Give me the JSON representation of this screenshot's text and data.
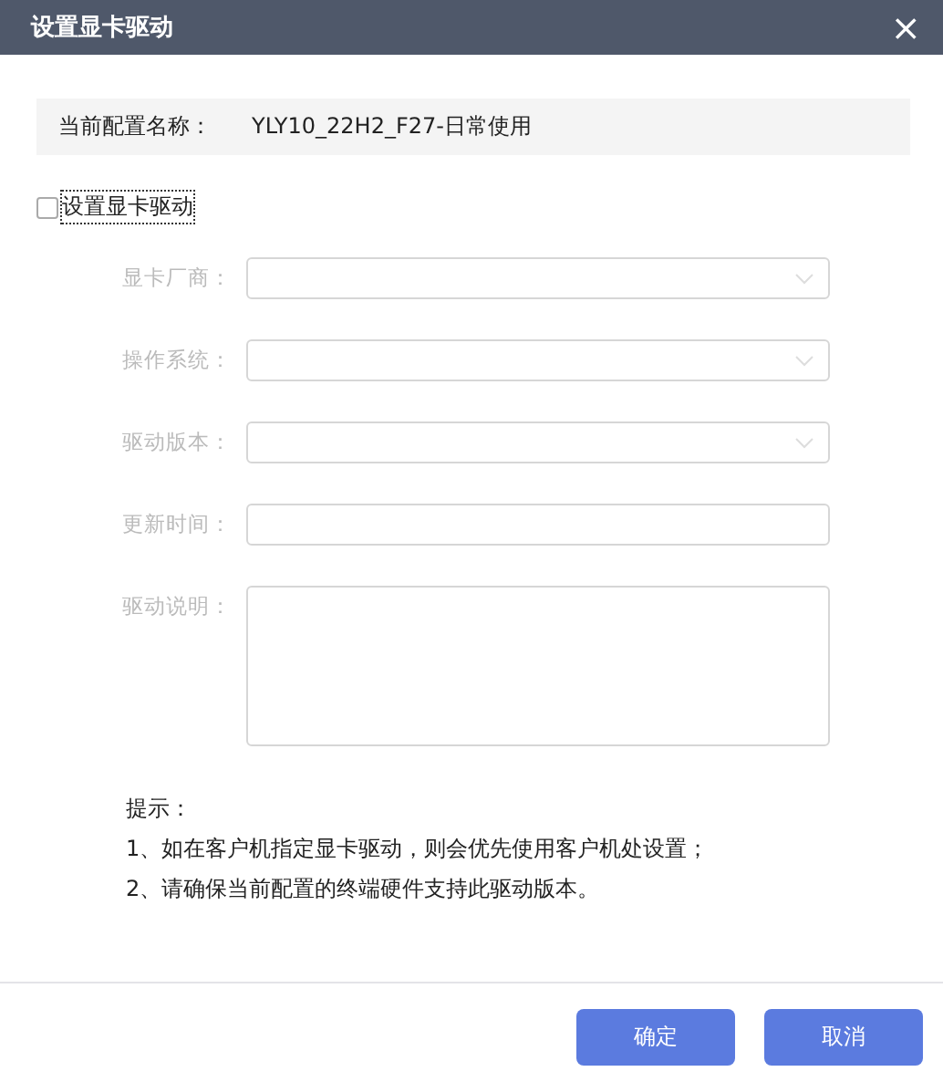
{
  "window": {
    "title": "设置显卡驱动",
    "close": "×"
  },
  "config": {
    "label": "当前配置名称：",
    "value": "YLY10_22H2_F27-日常使用"
  },
  "enable": {
    "label": "设置显卡驱动",
    "checked": false
  },
  "fields": [
    {
      "kind": "select",
      "label": "显卡厂商：",
      "disabled": true
    },
    {
      "kind": "select",
      "label": "操作系统：",
      "disabled": true
    },
    {
      "kind": "select",
      "label": "驱动版本：",
      "disabled": true
    },
    {
      "kind": "input",
      "label": "更新时间：",
      "disabled": true
    },
    {
      "kind": "textarea",
      "label": "驱动说明：",
      "disabled": true
    }
  ],
  "hints": [
    "提示：",
    "1、如在客户机指定显卡驱动，则会优先使用客户机处设置；",
    "2、请确保当前配置的终端硬件支持此驱动版本。"
  ],
  "buttons": [
    "确定",
    "取消"
  ]
}
